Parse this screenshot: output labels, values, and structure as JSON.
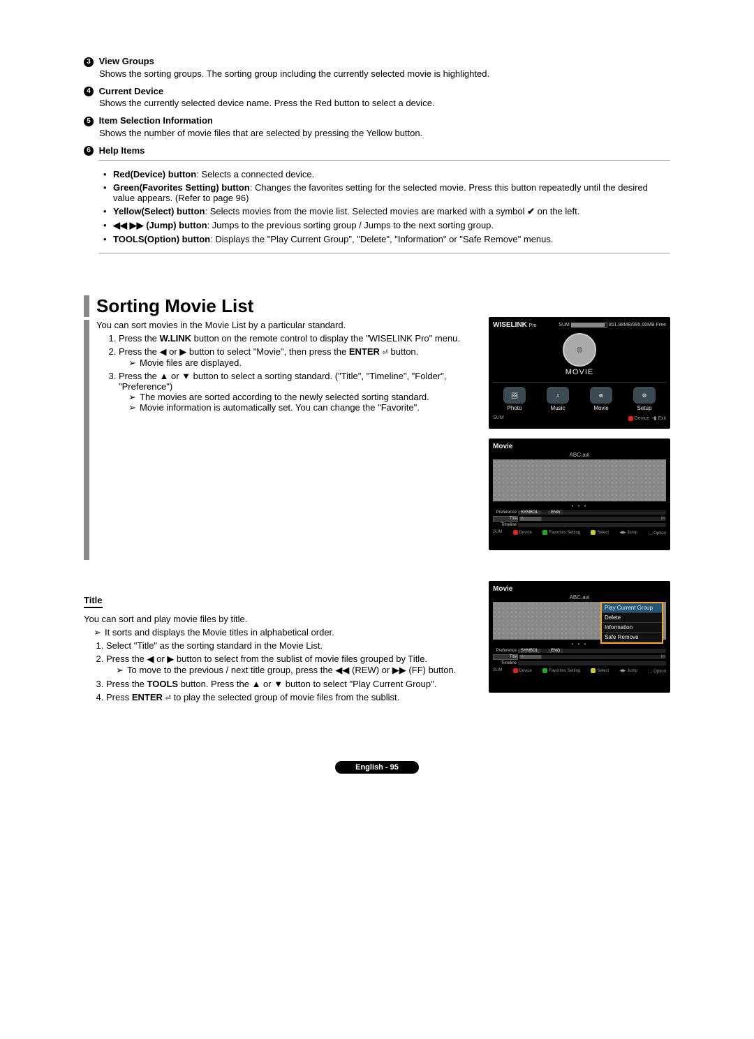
{
  "top_items": [
    {
      "num": "3",
      "title": "View Groups",
      "desc": "Shows the sorting groups. The sorting group including the currently selected movie is highlighted."
    },
    {
      "num": "4",
      "title": "Current Device",
      "desc": "Shows the currently selected device name. Press the Red button to select a device."
    },
    {
      "num": "5",
      "title": "Item Selection Information",
      "desc": "Shows the number of movie files that are selected by pressing the Yellow button."
    },
    {
      "num": "6",
      "title": "Help Items",
      "desc": ""
    }
  ],
  "help": {
    "red_label": "Red(Device) button",
    "red_text": ": Selects a connected device.",
    "green_label": "Green(Favorites Setting) button",
    "green_text": ": Changes the favorites setting for the selected movie. Press this button repeatedly until the desired value appears. (Refer to page 96)",
    "yellow_label": "Yellow(Select) button",
    "yellow_pre": ": Selects movies from the movie list. Selected movies are marked with a symbol ",
    "yellow_check": "✔",
    "yellow_post": " on the left.",
    "jump_label": "◀◀ ▶▶ (Jump) button",
    "jump_text": ": Jumps to the previous sorting group / Jumps to the next sorting group.",
    "tools_label": "TOOLS(Option) button",
    "tools_text": ": Displays the \"Play Current Group\", \"Delete\", \"Information\" or \"Safe Remove\" menus."
  },
  "section": {
    "title": "Sorting Movie List",
    "intro": "You can sort movies in the Movie List by a particular standard.",
    "step1_pre": "Press the ",
    "step1_bold": "W.LINK",
    "step1_post": " button on the remote control to display the \"WISELINK Pro\" menu.",
    "step2_pre": "Press the ◀ or ▶ button to select \"Movie\", then press the ",
    "step2_bold": "ENTER",
    "step2_icon": "⏎",
    "step2_post": " button.",
    "step2_note": "Movie files are displayed.",
    "step3": "Press the ▲ or ▼ button to select a sorting standard. (\"Title\", \"Timeline\", \"Folder\", \"Preference\")",
    "step3_note1": "The movies are sorted according to the newly selected sorting standard.",
    "step3_note2": "Movie information is automatically set. You can change the \"Favorite\"."
  },
  "title_section": {
    "heading": "Title",
    "intro": "You can sort and play movie files by title.",
    "note": "It sorts and displays the Movie titles in alphabetical order.",
    "s1": "Select \"Title\" as the sorting standard in the Movie List.",
    "s2": "Press the ◀ or ▶ button to select from the sublist of movie files grouped by Title.",
    "s2_note": "To move to the previous / next title group, press the ◀◀ (REW) or ▶▶ (FF) button.",
    "s3_pre": "Press the ",
    "s3_bold": "TOOLS",
    "s3_post": " button. Press the ▲ or ▼ button to select \"Play Current Group\".",
    "s4_pre": "Press ",
    "s4_bold": "ENTER",
    "s4_icon": "⏎",
    "s4_post": " to play the selected group of movie files from the sublist."
  },
  "screen1": {
    "brand": "WISELINK",
    "brand_sub": "Pro",
    "sum_label": "SUM",
    "storage": "851.98MB/995.00MB Free",
    "big_label": "MOVIE",
    "icons": {
      "photo": "Photo",
      "music": "Music",
      "movie": "Movie",
      "setup": "Setup"
    },
    "footer_left": "SUM",
    "footer_device": "Device",
    "footer_exit": "Exit"
  },
  "screen2": {
    "header": "Movie",
    "filename": "ABC.avi",
    "pref": "Preference",
    "title_lbl": "Title",
    "timeline_lbl": "Timeline",
    "tags": {
      "symbol": "SYMBOL",
      "eng": "ENG"
    },
    "range_a": "A",
    "range_m": "M",
    "footer_sum": "SUM",
    "footer_device": "Device",
    "footer_fav": "Favorites Setting",
    "footer_select": "Select",
    "footer_jump": "Jump",
    "footer_option": "Option"
  },
  "screen3": {
    "header": "Movie",
    "filename": "ABC.avi",
    "menu": {
      "play": "Play Current Group",
      "delete": "Delete",
      "info": "Information",
      "safe": "Safe Remove"
    },
    "pref": "Preference",
    "title_lbl": "Title",
    "timeline_lbl": "Timeline",
    "tags": {
      "symbol": "SYMBOL",
      "eng": "ENG"
    },
    "range_a": "A",
    "range_m": "M",
    "footer_sum": "SUM",
    "footer_device": "Device",
    "footer_fav": "Favorites Setting",
    "footer_select": "Select",
    "footer_jump": "Jump",
    "footer_option": "Option"
  },
  "footer": "English - 95"
}
